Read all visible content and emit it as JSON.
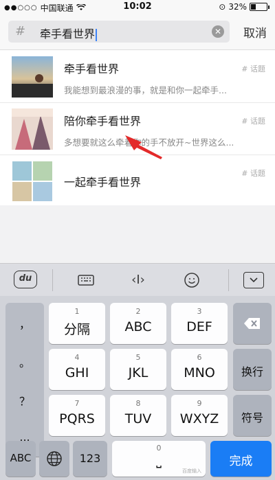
{
  "status": {
    "carrier": "中国联通",
    "time": "10:02",
    "battery": "32%"
  },
  "search": {
    "query": "牵手看世界",
    "cancel": "取消"
  },
  "results": [
    {
      "title": "牵手看世界",
      "subtitle": "我能想到最浪漫的事，就是和你一起牵手...",
      "tag": "话题"
    },
    {
      "title": "陪你牵手看世界",
      "subtitle": "多想要就这么牵着你的手不放开~世界这么...",
      "tag": "话题"
    },
    {
      "title": "一起牵手看世界",
      "subtitle": "",
      "tag": "话题"
    }
  ],
  "toolbar": {
    "logo": "du"
  },
  "keyboard": {
    "side_left": [
      "，",
      "。",
      "？",
      "..."
    ],
    "keys": [
      {
        "num": "1",
        "label": "分隔"
      },
      {
        "num": "2",
        "label": "ABC"
      },
      {
        "num": "3",
        "label": "DEF"
      },
      {
        "num": "4",
        "label": "GHI"
      },
      {
        "num": "5",
        "label": "JKL"
      },
      {
        "num": "6",
        "label": "MNO"
      },
      {
        "num": "7",
        "label": "PQRS"
      },
      {
        "num": "8",
        "label": "TUV"
      },
      {
        "num": "9",
        "label": "WXYZ"
      }
    ],
    "newline": "换行",
    "symbols": "符号",
    "abc": "ABC",
    "num123": "123",
    "space_num": "0",
    "space_brand": "百度输入",
    "done": "完成"
  }
}
